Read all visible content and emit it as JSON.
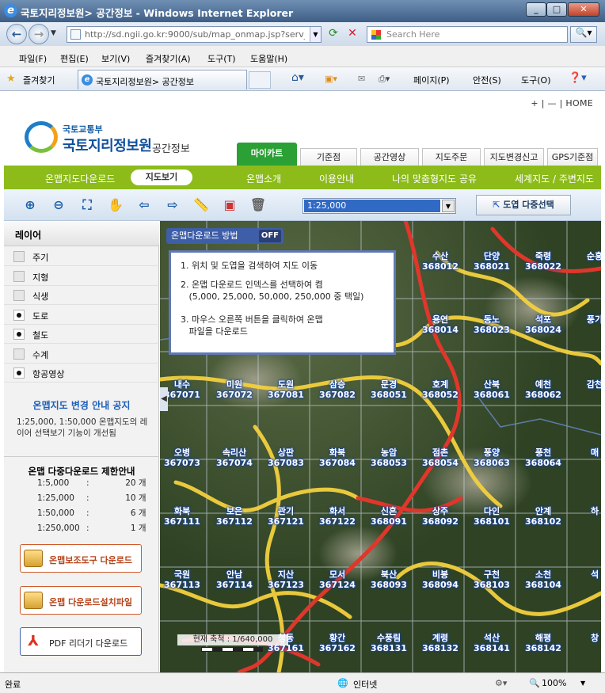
{
  "window": {
    "title": "국토지리정보원> 공간정보 - Windows Internet Explorer"
  },
  "nav": {
    "url": "http://sd.ngii.go.kr:9000/sub/map_onmap.jsp?serv_c",
    "search_placeholder": "Search Here"
  },
  "menu": {
    "items": [
      "파일(F)",
      "편집(E)",
      "보기(V)",
      "즐겨찾기(A)",
      "도구(T)",
      "도움말(H)"
    ]
  },
  "favbar": {
    "favorites_label": "즐겨찾기",
    "tab_title": "국토지리정보원> 공간정보",
    "commands": [
      "페이지(P)",
      "안전(S)",
      "도구(O)"
    ]
  },
  "site": {
    "top_links": "+ | — | HOME",
    "logo_sub": "국토교통부",
    "logo_main": "국토지리정보원",
    "logo_tail": "공간정보",
    "tabs": [
      "마이카트",
      "기준점",
      "공간영상",
      "지도주문",
      "지도변경신고",
      "GPS기준점"
    ],
    "green_nav": [
      "온맵지도다운로드",
      "지도보기",
      "온맵소개",
      "이용안내",
      "나의 맞춤형지도 공유",
      "세계지도 / 주변지도"
    ]
  },
  "toolbar": {
    "scale_value": "1:25,000",
    "multi_select": "도엽 다중선택"
  },
  "sidebar": {
    "header": "레이어",
    "layers": [
      {
        "name": "주기",
        "checked": false
      },
      {
        "name": "지형",
        "checked": false
      },
      {
        "name": "식생",
        "checked": false
      },
      {
        "name": "도로",
        "checked": true
      },
      {
        "name": "철도",
        "checked": true
      },
      {
        "name": "수계",
        "checked": false
      },
      {
        "name": "항공영상",
        "checked": true
      }
    ],
    "notice_title": "온맵지도 변경 안내 공지",
    "notice_text": "1:25,000, 1:50,000 온맵지도의 레이어 선택보기 기능이 개선됨",
    "limit_title": "온맵 다중다운로드 제한안내",
    "limits": [
      {
        "scale": "1:5,000",
        "count": "20 개"
      },
      {
        "scale": "1:25,000",
        "count": "10 개"
      },
      {
        "scale": "1:50,000",
        "count": "6 개"
      },
      {
        "scale": "1:250,000",
        "count": "1 개"
      }
    ],
    "buttons": [
      "온맵보조도구 다운로드",
      "온맵 다운로드설치파일",
      "PDF 리더기 다운로드"
    ]
  },
  "map": {
    "download_hint": "온맵다운로드 방법",
    "hint_state": "OFF",
    "steps": [
      "1. 위치 및 도엽을 검색하여 지도 이동",
      "2. 온맵 다운로드 인덱스를 선택하여 켬\n   (5,000, 25,000, 50,000, 250,000 중 택일)",
      "3. 마우스 오른쪽 버튼을 클릭하여 온맵\n   파일을 다운로드"
    ],
    "scale_text": "현재 축척 : 1/640,000",
    "cells": [
      [
        "",
        "",
        "",
        "",
        "",
        "수산\n368012",
        "단양\n368021",
        "죽령\n368022",
        "순흥\n"
      ],
      [
        "",
        "",
        "",
        "",
        "",
        "용연\n368014",
        "동노\n368023",
        "석포\n368024",
        "풍기\n"
      ],
      [
        "내수\n367071",
        "미원\n367072",
        "도원\n367081",
        "삼승\n367082",
        "문경\n368051",
        "호계\n368052",
        "산북\n368061",
        "예천\n368062",
        "감천\n"
      ],
      [
        "오병\n367073",
        "속리산\n367074",
        "상판\n367083",
        "화북\n367084",
        "농암\n368053",
        "점촌\n368054",
        "풍양\n368063",
        "풍천\n368064",
        "매\n"
      ],
      [
        "화북\n367111",
        "보은\n367112",
        "관기\n367121",
        "화서\n367122",
        "신흔\n368091",
        "상주\n368092",
        "다인\n368101",
        "안계\n368102",
        "하\n"
      ],
      [
        "국원\n367113",
        "안남\n367114",
        "지산\n367123",
        "모서\n367124",
        "북산\n368093",
        "비봉\n368094",
        "구천\n368103",
        "소천\n368104",
        "석\n"
      ],
      [
        "",
        "",
        "청동\n367161",
        "황간\n367162",
        "수풍림\n368131",
        "계령\n368132",
        "석산\n368141",
        "해평\n368142",
        "창\n"
      ]
    ]
  },
  "status": {
    "left": "완료",
    "zone": "인터넷",
    "zoom": "100%"
  }
}
